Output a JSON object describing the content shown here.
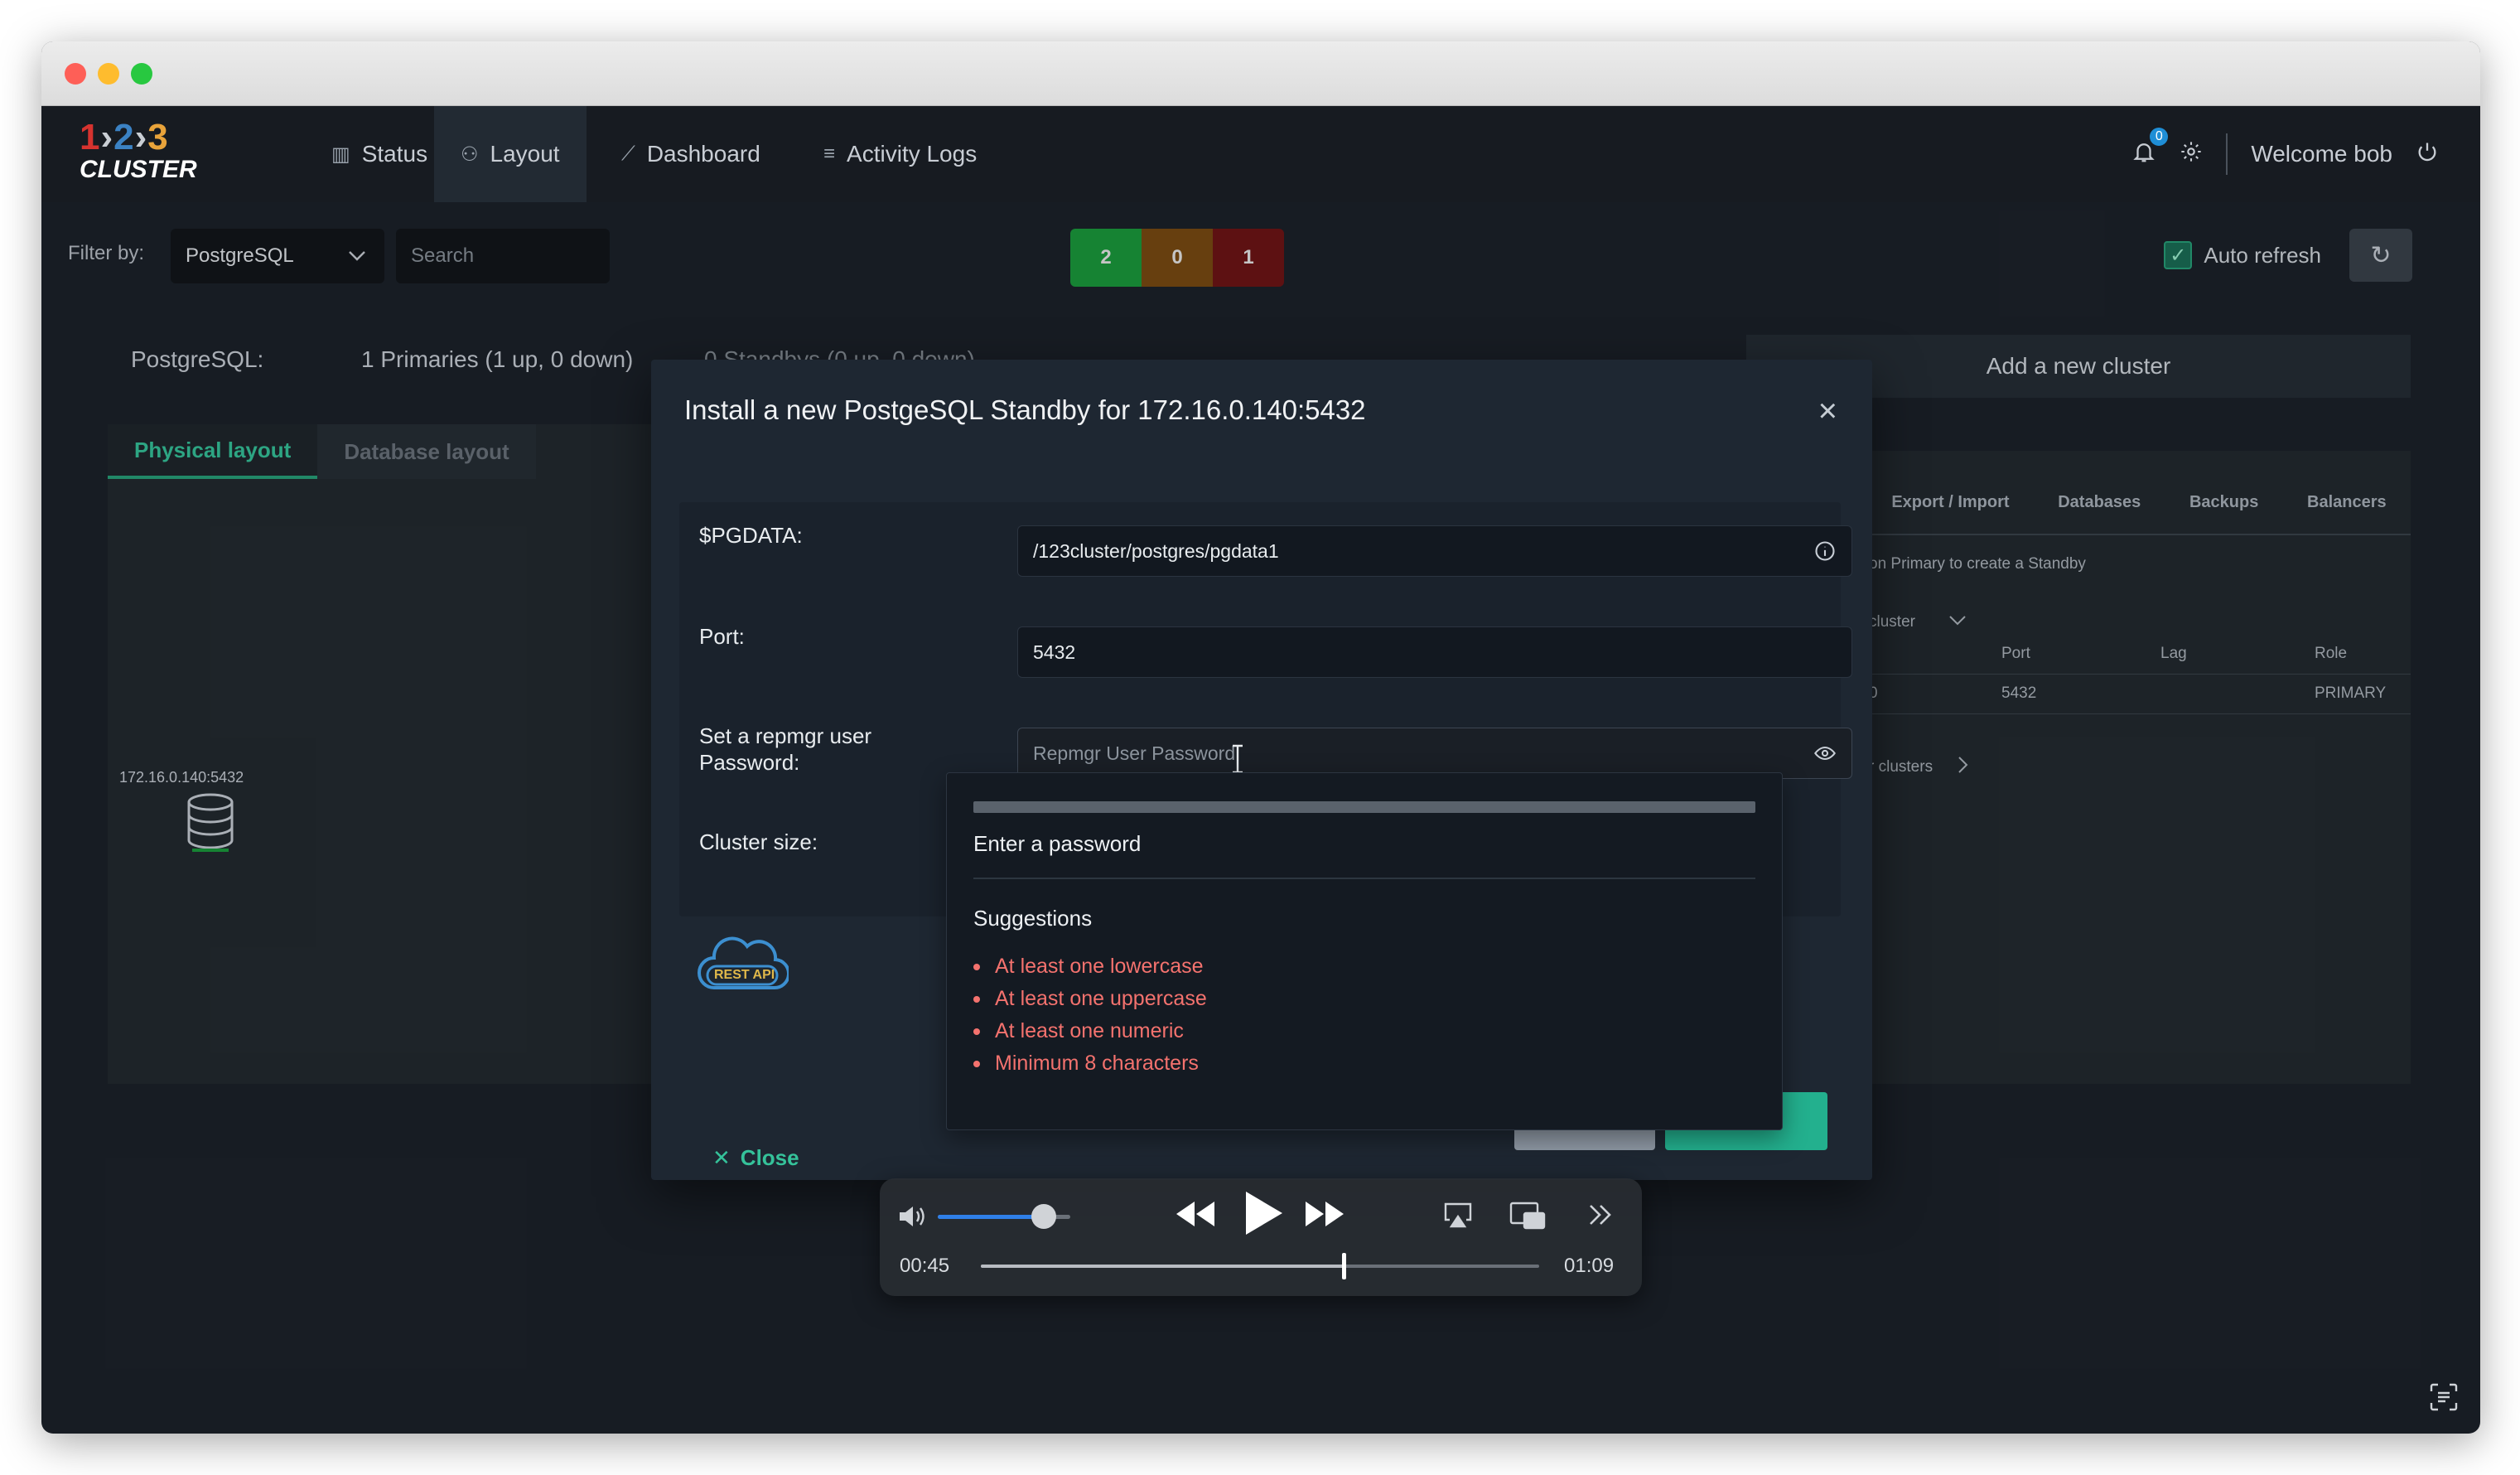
{
  "nav": {
    "logo_nums": [
      "1",
      "2",
      "3"
    ],
    "logo_word": "CLUSTER",
    "items": [
      {
        "label": "Status",
        "icon": "bar-chart-icon"
      },
      {
        "label": "Layout",
        "icon": "sitemap-icon"
      },
      {
        "label": "Dashboard",
        "icon": "line-chart-icon"
      },
      {
        "label": "Activity Logs",
        "icon": "list-icon"
      }
    ],
    "notification_count": "0",
    "welcome": "Welcome bob"
  },
  "filter": {
    "label": "Filter by:",
    "selected": "PostgreSQL",
    "search_placeholder": "Search"
  },
  "counts": [
    {
      "value": "2",
      "color": "#1a9a3c"
    },
    {
      "value": "0",
      "color": "#7a4a12"
    },
    {
      "value": "1",
      "color": "#6e1416"
    }
  ],
  "autorefresh": {
    "label": "Auto refresh",
    "checked": true
  },
  "summary": {
    "label": "PostgreSQL:",
    "primaries": "1 Primaries (1 up, 0 down)",
    "standbys": "0 Standbys (0 up, 0 down)"
  },
  "add_cluster": "Add a new cluster",
  "left_tabs": [
    "Physical layout",
    "Database layout"
  ],
  "node": {
    "label": "172.16.0.140:5432"
  },
  "right_panel": {
    "tabs": [
      "Export / Import",
      "Databases",
      "Backups",
      "Balancers"
    ],
    "hint": "on Primary to create a Standby",
    "dropdown": "cluster",
    "columns": [
      "Port",
      "Lag",
      "Role"
    ],
    "row": {
      "ip_tail": "0",
      "port": "5432",
      "lag": "",
      "role": "PRIMARY"
    },
    "link": "r clusters"
  },
  "modal": {
    "title": "Install a new PostgeSQL Standby for 172.16.0.140:5432",
    "fields": {
      "pgdata_label": "$PGDATA:",
      "pgdata_value": "/123cluster/postgres/pgdata1",
      "port_label": "Port:",
      "port_value": "5432",
      "password_label": "Set a repmgr user Password:",
      "password_placeholder": "Repmgr User Password",
      "cluster_size_label": "Cluster size:"
    },
    "restapi_label": "REST API",
    "close_label": "Close"
  },
  "password_popover": {
    "status": "Enter a password",
    "suggestions_title": "Suggestions",
    "suggestions": [
      "At least one lowercase",
      "At least one uppercase",
      "At least one numeric",
      "Minimum 8 characters"
    ],
    "strength": 0
  },
  "player": {
    "current_time": "00:45",
    "total_time": "01:09",
    "progress": 0.65,
    "volume": 0.8
  }
}
